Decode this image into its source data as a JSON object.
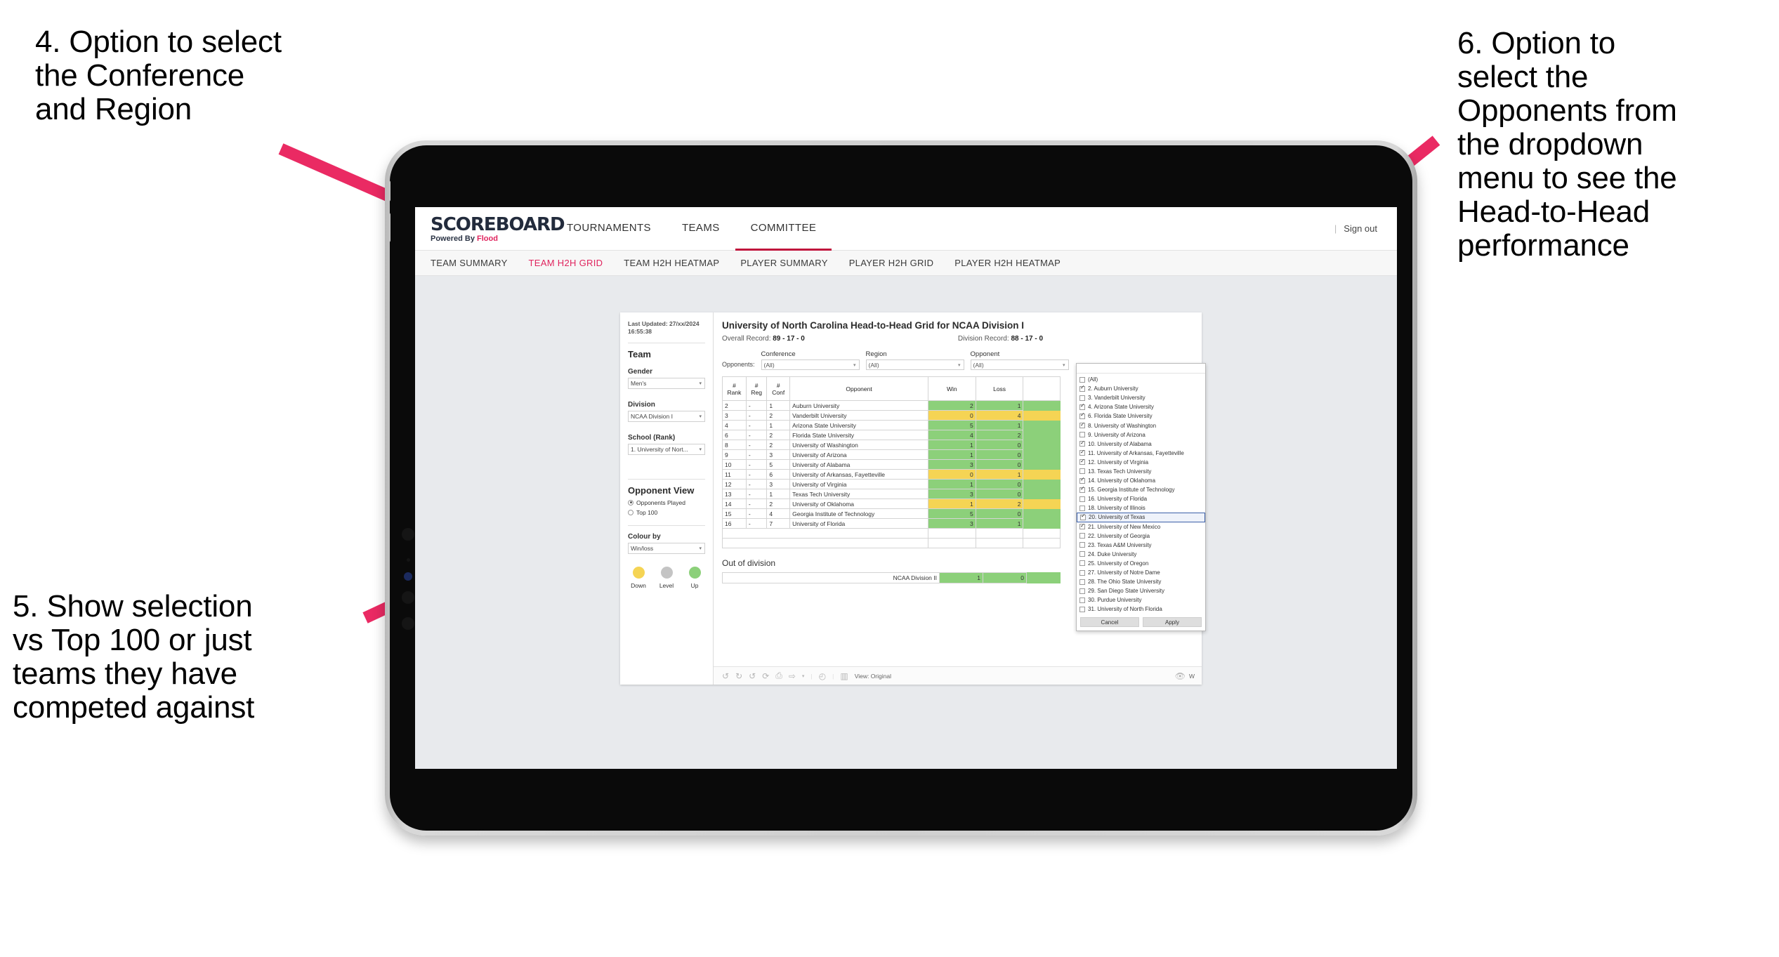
{
  "annotations": {
    "left_top": "4. Option to select\nthe Conference\nand Region",
    "left_bottom": "5. Show selection\nvs Top 100 or just\nteams they have\ncompeted against",
    "right": "6. Option to\nselect the\nOpponents from\nthe dropdown\nmenu to see the\nHead-to-Head\nperformance"
  },
  "colors": {
    "arrow": "#ea2a63",
    "accent": "#e0245e",
    "up": "#8cd07a",
    "level": "#c4c4c4",
    "down": "#f5d454"
  },
  "app": {
    "brand_title": "SCOREBOARD",
    "brand_sub_prefix": "Powered By ",
    "brand_sub_accent": "Flood",
    "nav": [
      {
        "label": "TOURNAMENTS",
        "active": false
      },
      {
        "label": "TEAMS",
        "active": false
      },
      {
        "label": "COMMITTEE",
        "active": true
      }
    ],
    "signout": "Sign out",
    "subnav": [
      {
        "label": "TEAM SUMMARY",
        "active": false
      },
      {
        "label": "TEAM H2H GRID",
        "active": true
      },
      {
        "label": "TEAM H2H HEATMAP",
        "active": false
      },
      {
        "label": "PLAYER SUMMARY",
        "active": false
      },
      {
        "label": "PLAYER H2H GRID",
        "active": false
      },
      {
        "label": "PLAYER H2H HEATMAP",
        "active": false
      }
    ]
  },
  "sidebar": {
    "last_updated": "Last Updated: 27/xx/2024 16:55:38",
    "team_heading": "Team",
    "gender_label": "Gender",
    "gender_value": "Men's",
    "division_label": "Division",
    "division_value": "NCAA Division I",
    "school_label": "School (Rank)",
    "school_value": "1. University of Nort...",
    "opponent_view_heading": "Opponent View",
    "opponent_view_options": [
      {
        "label": "Opponents Played",
        "selected": true
      },
      {
        "label": "Top 100",
        "selected": false
      }
    ],
    "colour_by_label": "Colour by",
    "colour_by_value": "Win/loss",
    "legend": [
      {
        "label": "Down",
        "color": "#f5d454"
      },
      {
        "label": "Level",
        "color": "#c4c4c4"
      },
      {
        "label": "Up",
        "color": "#8cd07a"
      }
    ]
  },
  "viz": {
    "title": "University of North Carolina Head-to-Head Grid for NCAA Division I",
    "overall_record_label": "Overall Record:",
    "overall_record_value": "89 - 17 - 0",
    "division_record_label": "Division Record:",
    "division_record_value": "88 - 17 - 0",
    "opponents_label": "Opponents:",
    "filters": [
      {
        "name": "Conference",
        "value": "(All)"
      },
      {
        "name": "Region",
        "value": "(All)"
      },
      {
        "name": "Opponent",
        "value": "(All)"
      }
    ],
    "columns": [
      "#\nRank",
      "#\nReg",
      "#\nConf",
      "Opponent",
      "Win",
      "Loss",
      ""
    ],
    "rows": [
      {
        "rank": "2",
        "reg": "-",
        "conf": "1",
        "opponent": "Auburn University",
        "win": "2",
        "loss": "1",
        "state": "up"
      },
      {
        "rank": "3",
        "reg": "-",
        "conf": "2",
        "opponent": "Vanderbilt University",
        "win": "0",
        "loss": "4",
        "state": "down"
      },
      {
        "rank": "4",
        "reg": "-",
        "conf": "1",
        "opponent": "Arizona State University",
        "win": "5",
        "loss": "1",
        "state": "up"
      },
      {
        "rank": "6",
        "reg": "-",
        "conf": "2",
        "opponent": "Florida State University",
        "win": "4",
        "loss": "2",
        "state": "up"
      },
      {
        "rank": "8",
        "reg": "-",
        "conf": "2",
        "opponent": "University of Washington",
        "win": "1",
        "loss": "0",
        "state": "up"
      },
      {
        "rank": "9",
        "reg": "-",
        "conf": "3",
        "opponent": "University of Arizona",
        "win": "1",
        "loss": "0",
        "state": "up"
      },
      {
        "rank": "10",
        "reg": "-",
        "conf": "5",
        "opponent": "University of Alabama",
        "win": "3",
        "loss": "0",
        "state": "up"
      },
      {
        "rank": "11",
        "reg": "-",
        "conf": "6",
        "opponent": "University of Arkansas, Fayetteville",
        "win": "0",
        "loss": "1",
        "state": "down"
      },
      {
        "rank": "12",
        "reg": "-",
        "conf": "3",
        "opponent": "University of Virginia",
        "win": "1",
        "loss": "0",
        "state": "up"
      },
      {
        "rank": "13",
        "reg": "-",
        "conf": "1",
        "opponent": "Texas Tech University",
        "win": "3",
        "loss": "0",
        "state": "up"
      },
      {
        "rank": "14",
        "reg": "-",
        "conf": "2",
        "opponent": "University of Oklahoma",
        "win": "1",
        "loss": "2",
        "state": "down"
      },
      {
        "rank": "15",
        "reg": "-",
        "conf": "4",
        "opponent": "Georgia Institute of Technology",
        "win": "5",
        "loss": "0",
        "state": "up"
      },
      {
        "rank": "16",
        "reg": "-",
        "conf": "7",
        "opponent": "University of Florida",
        "win": "3",
        "loss": "1",
        "state": "up"
      }
    ],
    "out_of_division_heading": "Out of division",
    "out_of_division_row": {
      "label": "NCAA Division II",
      "win": "1",
      "loss": "0",
      "state": "up"
    }
  },
  "toolbar": {
    "view_label": "View: Original",
    "right_label": "W"
  },
  "opponent_popup": {
    "options": [
      {
        "label": "(All)",
        "checked": false,
        "highlighted": false
      },
      {
        "label": "2. Auburn University",
        "checked": true,
        "highlighted": false
      },
      {
        "label": "3. Vanderbilt University",
        "checked": false,
        "highlighted": false
      },
      {
        "label": "4. Arizona State University",
        "checked": true,
        "highlighted": false
      },
      {
        "label": "6. Florida State University",
        "checked": true,
        "highlighted": false
      },
      {
        "label": "8. University of Washington",
        "checked": true,
        "highlighted": false
      },
      {
        "label": "9. University of Arizona",
        "checked": false,
        "highlighted": false
      },
      {
        "label": "10. University of Alabama",
        "checked": true,
        "highlighted": false
      },
      {
        "label": "11. University of Arkansas, Fayetteville",
        "checked": true,
        "highlighted": false
      },
      {
        "label": "12. University of Virginia",
        "checked": true,
        "highlighted": false
      },
      {
        "label": "13. Texas Tech University",
        "checked": false,
        "highlighted": false
      },
      {
        "label": "14. University of Oklahoma",
        "checked": true,
        "highlighted": false
      },
      {
        "label": "15. Georgia Institute of Technology",
        "checked": true,
        "highlighted": false
      },
      {
        "label": "16. University of Florida",
        "checked": false,
        "highlighted": false
      },
      {
        "label": "18. University of Illinois",
        "checked": false,
        "highlighted": false
      },
      {
        "label": "20. University of Texas",
        "checked": true,
        "highlighted": true
      },
      {
        "label": "21. University of New Mexico",
        "checked": true,
        "highlighted": false
      },
      {
        "label": "22. University of Georgia",
        "checked": false,
        "highlighted": false
      },
      {
        "label": "23. Texas A&M University",
        "checked": false,
        "highlighted": false
      },
      {
        "label": "24. Duke University",
        "checked": false,
        "highlighted": false
      },
      {
        "label": "25. University of Oregon",
        "checked": false,
        "highlighted": false
      },
      {
        "label": "27. University of Notre Dame",
        "checked": false,
        "highlighted": false
      },
      {
        "label": "28. The Ohio State University",
        "checked": false,
        "highlighted": false
      },
      {
        "label": "29. San Diego State University",
        "checked": false,
        "highlighted": false
      },
      {
        "label": "30. Purdue University",
        "checked": false,
        "highlighted": false
      },
      {
        "label": "31. University of North Florida",
        "checked": false,
        "highlighted": false
      }
    ],
    "cancel_label": "Cancel",
    "apply_label": "Apply"
  }
}
